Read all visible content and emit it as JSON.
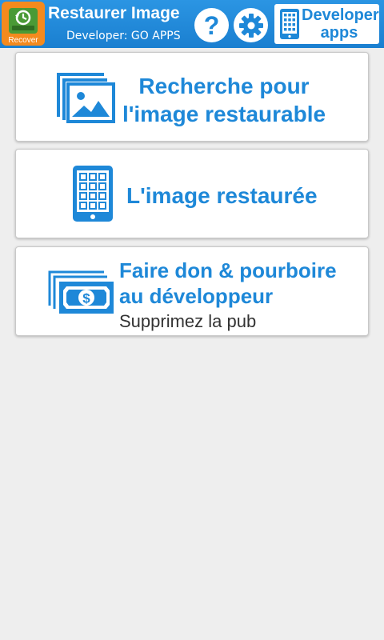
{
  "header": {
    "app_icon_label": "Recover",
    "title": "Restaurer Image",
    "subtitle": "Developer: GO APPS",
    "help_glyph": "?",
    "developer_apps_label": "Developer apps",
    "developer_apps_line1": "Developer",
    "developer_apps_line2": "apps",
    "icons": [
      "recover-app-icon",
      "help-icon",
      "gear-icon",
      "tablet-grid-icon"
    ]
  },
  "cards": [
    {
      "icon": "images-stack-icon",
      "line1": "Recherche pour",
      "line2": "l'image restaurable"
    },
    {
      "icon": "tablet-grid-icon",
      "line1": "L'image restaurée"
    },
    {
      "icon": "money-stack-icon",
      "line1": "Faire don & pourboire",
      "line2": "au développeur",
      "sub": "Supprimez la pub"
    }
  ],
  "colors": {
    "accent": "#1e88d8",
    "header_bg": "#1e88d8",
    "app_icon_bg": "#f48a1e",
    "background": "#eeeeee",
    "card_bg": "#ffffff",
    "sub_text": "#333333"
  }
}
